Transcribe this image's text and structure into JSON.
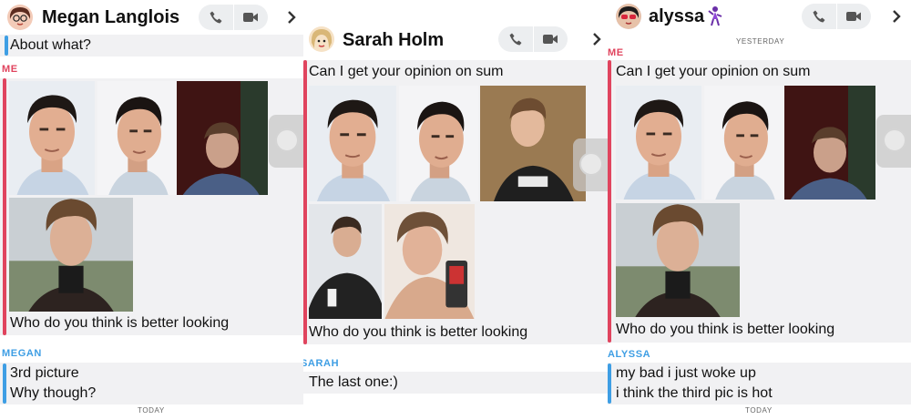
{
  "panels": [
    {
      "contact_name": "Megan Langlois",
      "messages_top": [
        "About what?"
      ],
      "me_label": "ME",
      "me_messages": [
        "Who do you think is better looking"
      ],
      "reply_label": "MEGAN",
      "reply_messages": [
        "3rd picture",
        "Why though?"
      ],
      "footer_stamp": "TODAY"
    },
    {
      "contact_name": "Sarah Holm",
      "me_messages": [
        "Can I get your opinion on sum",
        "Who do you think is better looking"
      ],
      "reply_label": "SARAH",
      "reply_messages": [
        "The last one:)"
      ]
    },
    {
      "contact_name": "alyssa",
      "top_stamp": "YESTERDAY",
      "me_label": "ME",
      "me_messages": [
        "Can I get your opinion on sum",
        "Who do you think is better looking"
      ],
      "reply_label": "ALYSSA",
      "reply_messages": [
        "my bad i just woke up",
        "i think the third pic is hot"
      ],
      "footer_stamp": "TODAY"
    }
  ],
  "icons": {
    "call": "phone-icon",
    "video": "video-camera-icon",
    "more": "chevron-right-icon"
  },
  "colors": {
    "me_accent": "#e0445e",
    "friend_accent": "#3e9ee4",
    "bubble_bg": "#f1f1f3"
  }
}
